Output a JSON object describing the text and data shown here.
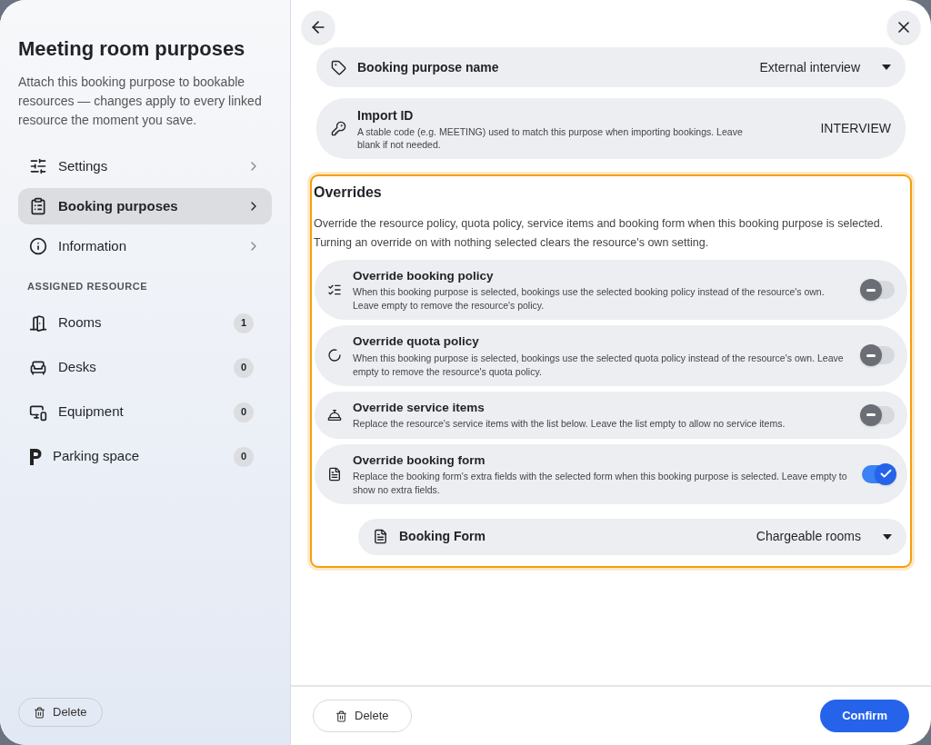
{
  "sidebar": {
    "title": "Meeting room purposes",
    "description": "Attach this booking purpose to bookable resources — changes apply to every linked resource the moment you save.",
    "nav": [
      {
        "kind": "settings",
        "label": "Settings",
        "selected": false
      },
      {
        "kind": "purposes",
        "label": "Booking purposes",
        "selected": true
      },
      {
        "kind": "info",
        "label": "Information",
        "selected": false
      }
    ],
    "section_label": "ASSIGNED RESOURCE",
    "resources": [
      {
        "kind": "room",
        "label": "Rooms",
        "count": "1"
      },
      {
        "kind": "desk",
        "label": "Desks",
        "count": "0"
      },
      {
        "kind": "equipment",
        "label": "Equipment",
        "count": "0"
      },
      {
        "kind": "parking",
        "label": "Parking space",
        "count": "0"
      }
    ],
    "delete_button": "Delete"
  },
  "main": {
    "name_field": {
      "label": "Booking purpose name",
      "value": "External interview"
    },
    "import_id": {
      "label": "Import ID",
      "hint": "A stable code (e.g. MEETING) used to match this purpose when importing bookings. Leave blank if not needed.",
      "value": "INTERVIEW"
    },
    "overrides": {
      "title": "Overrides",
      "description": "Override the resource policy, quota policy, service items and booking form when this booking purpose is selected. Turning an override on with nothing selected clears the resource's own setting.",
      "items": [
        {
          "kind": "policy",
          "title": "Override booking policy",
          "description": "When this booking purpose is selected, bookings use the selected booking policy instead of the resource's own. Leave empty to remove the resource's policy.",
          "on": false
        },
        {
          "kind": "quota",
          "title": "Override quota policy",
          "description": "When this booking purpose is selected, bookings use the selected quota policy instead of the resource's own. Leave empty to remove the resource's quota policy.",
          "on": false
        },
        {
          "kind": "service",
          "title": "Override service items",
          "description": "Replace the resource's service items with the list below. Leave the list empty to allow no service items.",
          "on": false
        },
        {
          "kind": "form",
          "title": "Override booking form",
          "description": "Replace the booking form's extra fields with the selected form when this booking purpose is selected. Leave empty to show no extra fields.",
          "on": true
        }
      ],
      "form_select": {
        "label": "Booking Form",
        "value": "Chargeable rooms"
      }
    },
    "delete_button": "Delete",
    "confirm_button": "Confirm"
  }
}
